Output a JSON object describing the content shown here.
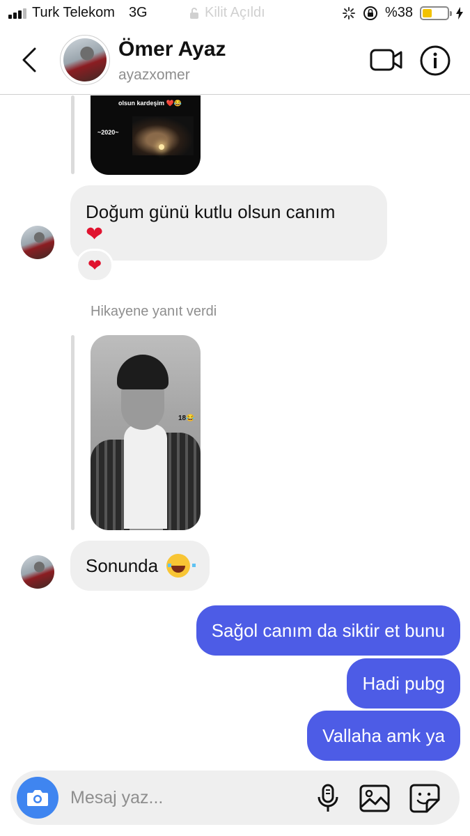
{
  "status_bar": {
    "carrier": "Turk Telekom",
    "network": "3G",
    "lock_status": "Kilit Açıldı",
    "battery_percent": "%38",
    "battery_level": 0.38
  },
  "header": {
    "name": "Ömer Ayaz",
    "username": "ayazxomer"
  },
  "chat": {
    "story_caption": "olsun kardeşim ❤️😂",
    "story_year": "~2020~",
    "message_1_text": "Doğum günü kutlu olsun canım",
    "message_1_heart": "❤",
    "reaction": "❤",
    "replied_label": "Hikayene yanıt verdi",
    "story_tag": "18😂",
    "message_2_text": "Sonunda",
    "outgoing": [
      "Sağol canım da siktir et bunu",
      "Hadi pubg",
      "Vallaha amk ya"
    ]
  },
  "composer": {
    "placeholder": "Mesaj yaz..."
  },
  "colors": {
    "outgoing_bubble": "#4d5ce6",
    "incoming_bubble": "#efefef",
    "camera_button": "#3f85f0",
    "heart": "#e0132f"
  }
}
